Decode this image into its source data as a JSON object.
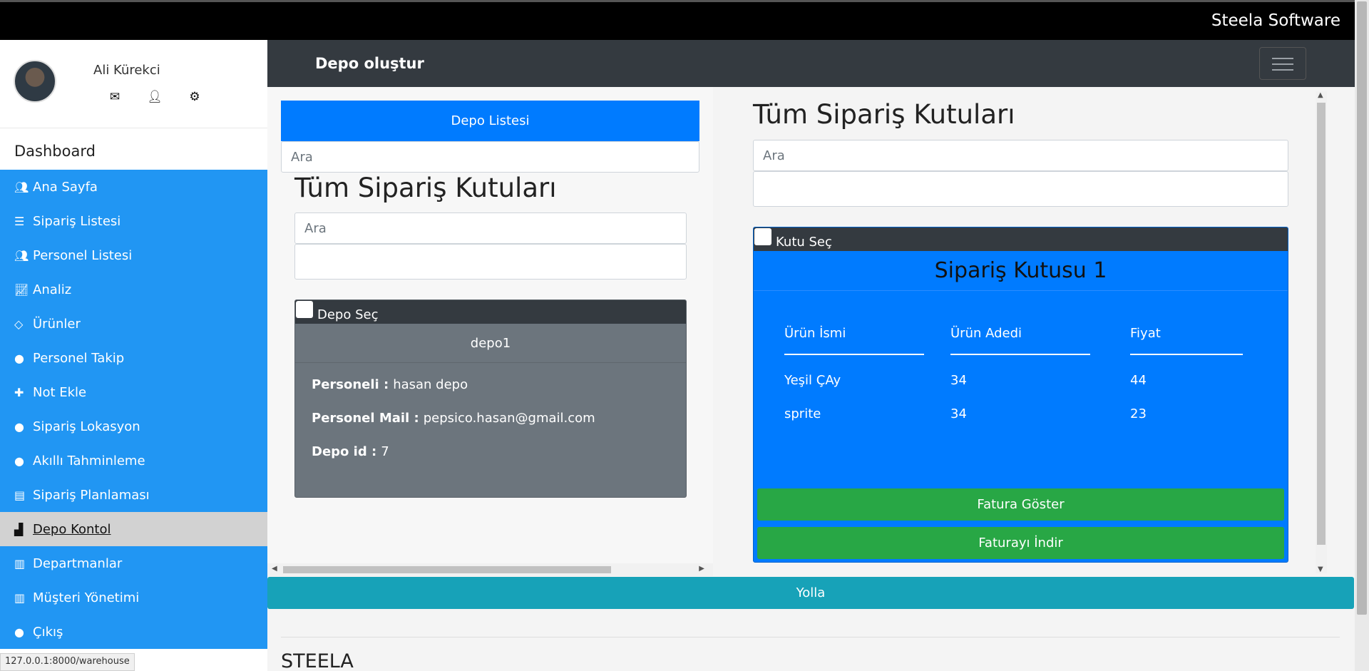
{
  "topbar": {
    "brand": "Steela Software"
  },
  "profile": {
    "name": "Ali Kürekci",
    "icons": [
      "envelope-icon",
      "user-icon",
      "gear-icon"
    ]
  },
  "sidebar": {
    "heading": "Dashboard",
    "items": [
      {
        "label": "Ana Sayfa",
        "icon": "users-icon"
      },
      {
        "label": "Sipariş Listesi",
        "icon": "list-icon"
      },
      {
        "label": "Personel Listesi",
        "icon": "users-icon"
      },
      {
        "label": "Analiz",
        "icon": "chart-line-icon"
      },
      {
        "label": "Ürünler",
        "icon": "diamond-icon"
      },
      {
        "label": "Personel Takip",
        "icon": "globe-icon"
      },
      {
        "label": "Not Ekle",
        "icon": "plus-icon"
      },
      {
        "label": "Sipariş Lokasyon",
        "icon": "globe-icon"
      },
      {
        "label": "Akıllı Tahminleme",
        "icon": "globe-icon"
      },
      {
        "label": "Sipariş Planlaması",
        "icon": "book-icon"
      },
      {
        "label": "Depo Kontol",
        "icon": "industry-icon",
        "active": true
      },
      {
        "label": "Departmanlar",
        "icon": "building-icon"
      },
      {
        "label": "Müşteri Yönetimi",
        "icon": "building-icon"
      },
      {
        "label": "Çıkış",
        "icon": "globe-icon"
      }
    ]
  },
  "status_url": "127.0.0.1:8000/warehouse",
  "header": {
    "title": "Depo oluştur"
  },
  "left": {
    "list_button": "Depo Listesi",
    "search_placeholder": "Ara",
    "heading": "Tüm Sipariş Kutuları",
    "inner_search_placeholder": "Ara",
    "card": {
      "select_label": "Depo Seç",
      "title": "depo1",
      "personel_label": "Personeli :",
      "personel_value": "hasan depo",
      "mail_label": "Personel Mail :",
      "mail_value": "pepsico.hasan@gmail.com",
      "id_label": "Depo id :",
      "id_value": "7"
    }
  },
  "right": {
    "heading": "Tüm Sipariş Kutuları",
    "search_placeholder": "Ara",
    "box": {
      "select_label": "Kutu Seç",
      "title": "Sipariş Kutusu 1",
      "columns": [
        "Ürün İsmi",
        "Ürün Adedi",
        "Fiyat"
      ],
      "rows": [
        [
          "Yeşil ÇAy",
          "34",
          "44"
        ],
        [
          "sprite",
          "34",
          "23"
        ]
      ],
      "show_invoice": "Fatura Göster",
      "download_invoice": "Faturayı İndir"
    }
  },
  "send_button": "Yolla",
  "footer": {
    "brand": "STEELA"
  },
  "colors": {
    "primary": "#007bff",
    "sidebar": "#2196f3",
    "success": "#28a745",
    "info": "#17a2b8",
    "dark": "#343a40",
    "secondary": "#6c757d"
  }
}
